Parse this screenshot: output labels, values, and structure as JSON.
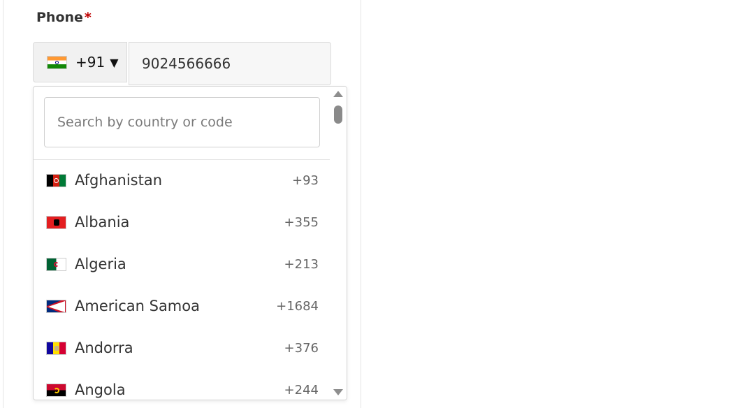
{
  "form": {
    "phone_label": "Phone",
    "required_marker": "*",
    "selected_dial_code": "+91",
    "selected_flag": "india-flag-icon",
    "caret": "▼",
    "phone_value": "9024566666"
  },
  "dropdown": {
    "search_placeholder": "Search by country or code",
    "countries": [
      {
        "name": "Afghanistan",
        "code": "+93",
        "flag": "afghanistan-flag-icon"
      },
      {
        "name": "Albania",
        "code": "+355",
        "flag": "albania-flag-icon"
      },
      {
        "name": "Algeria",
        "code": "+213",
        "flag": "algeria-flag-icon"
      },
      {
        "name": "American Samoa",
        "code": "+1684",
        "flag": "american-samoa-flag-icon"
      },
      {
        "name": "Andorra",
        "code": "+376",
        "flag": "andorra-flag-icon"
      },
      {
        "name": "Angola",
        "code": "+244",
        "flag": "angola-flag-icon"
      }
    ]
  },
  "colors": {
    "required": "#c00000",
    "label_text": "#333333",
    "scrollbar": "#8a8a8a"
  }
}
